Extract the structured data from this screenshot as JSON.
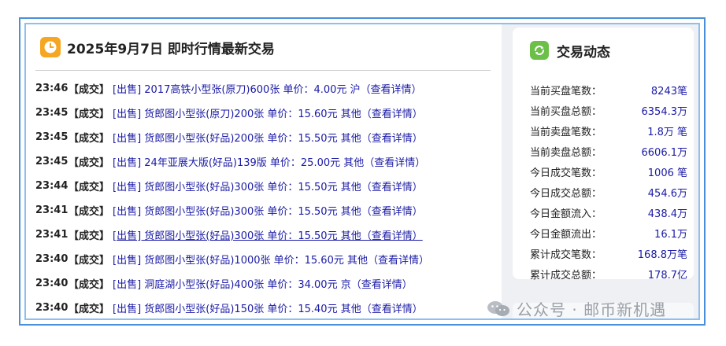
{
  "main": {
    "title": "2025年9月7日 即时行情最新交易",
    "rows": [
      {
        "time": "23:46",
        "tag": "【成交】",
        "desc": "[出售] 2017高铁小型张(原刀)600张 单价：4.00元 沪（查看详情）"
      },
      {
        "time": "23:45",
        "tag": "【成交】",
        "desc": "[出售] 货郎图小型张(原刀)200张 单价：15.60元 其他（查看详情）"
      },
      {
        "time": "23:45",
        "tag": "【成交】",
        "desc": "[出售] 货郎图小型张(好品)200张 单价：15.50元 其他（查看详情）"
      },
      {
        "time": "23:45",
        "tag": "【成交】",
        "desc": "[出售] 24年亚展大版(好品)139版 单价：25.00元 其他（查看详情）"
      },
      {
        "time": "23:44",
        "tag": "【成交】",
        "desc": "[出售] 货郎图小型张(好品)300张 单价：15.50元 其他（查看详情）"
      },
      {
        "time": "23:41",
        "tag": "【成交】",
        "desc": "[出售] 货郎图小型张(好品)300张 单价：15.50元 其他（查看详情）"
      },
      {
        "time": "23:41",
        "tag": "【成交】",
        "desc": "[出售] 货郎图小型张(好品)300张 单价：15.50元 其他（查看详情）"
      },
      {
        "time": "23:40",
        "tag": "【成交】",
        "desc": "[出售] 货郎图小型张(好品)1000张 单价：15.60元 其他（查看详情）"
      },
      {
        "time": "23:40",
        "tag": "【成交】",
        "desc": "[出售] 洞庭湖小型张(好品)400张 单价：34.00元 京（查看详情）"
      },
      {
        "time": "23:40",
        "tag": "【成交】",
        "desc": "[出售] 货郎图小型张(好品)150张 单价：15.40元 其他（查看详情）"
      }
    ]
  },
  "panel": {
    "title": "交易动态",
    "stats": [
      {
        "k": "当前买盘笔数：",
        "v": "8243笔"
      },
      {
        "k": "当前买盘总额：",
        "v": "6354.3万"
      },
      {
        "k": "当前卖盘笔数：",
        "v": "1.8万 笔"
      },
      {
        "k": "当前卖盘总额：",
        "v": "6606.1万"
      },
      {
        "k": "今日成交笔数：",
        "v": "1006 笔"
      },
      {
        "k": "今日成交总额：",
        "v": "454.6万"
      },
      {
        "k": "今日金额流入：",
        "v": "438.4万"
      },
      {
        "k": "今日金额流出：",
        "v": "16.1万"
      },
      {
        "k": "累计成交笔数：",
        "v": "168.8万笔"
      },
      {
        "k": "累计成交总额：",
        "v": "178.7亿"
      }
    ]
  },
  "watermark": {
    "text": "公众号 · 邮币新机遇"
  },
  "colors": {
    "accent": "#4a90d9",
    "link": "#1a1aa6",
    "clock": "#f5a623",
    "refresh": "#6cc04a"
  },
  "icons": {
    "title": "clock-icon",
    "panel": "refresh-icon",
    "watermark": "wechat-icon"
  }
}
